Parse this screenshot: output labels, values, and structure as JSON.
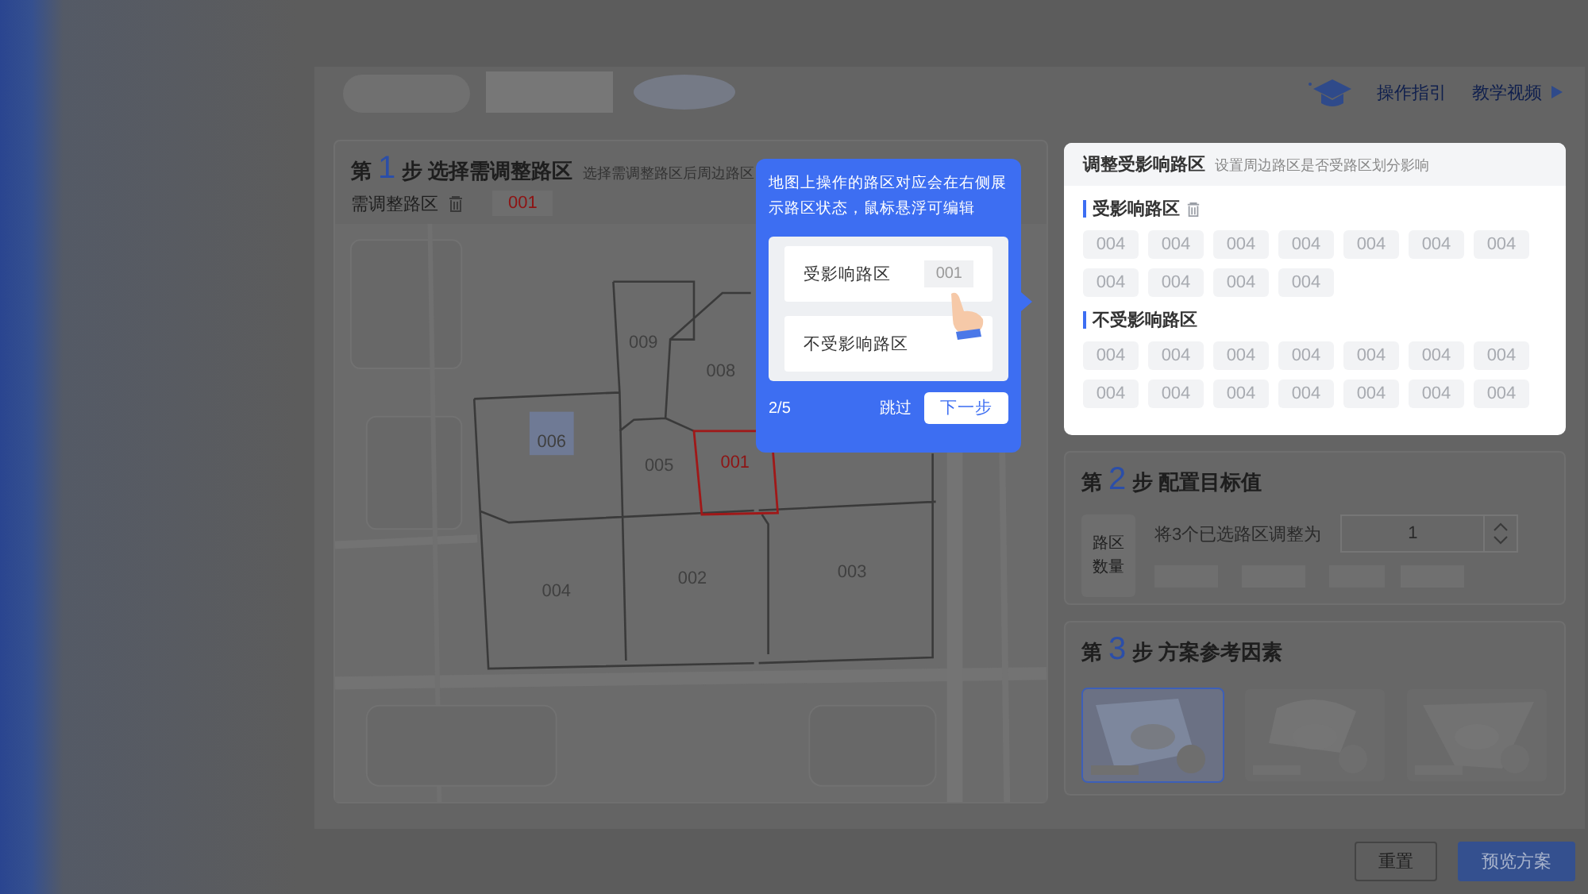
{
  "header": {
    "links": [
      {
        "label": "操作指引",
        "kind": "plain"
      },
      {
        "label": "教学视频",
        "kind": "play"
      }
    ]
  },
  "step1": {
    "prefix": "第",
    "number": "1",
    "suffix": "步",
    "title": "选择需调整路区",
    "hint": "选择需调整路区后周边路区",
    "field_label": "需调整路区",
    "selected_chip": "001",
    "districts": [
      {
        "label": "009",
        "selected": false,
        "highlighted": false
      },
      {
        "label": "008",
        "selected": false,
        "highlighted": false
      },
      {
        "label": "006",
        "selected": false,
        "highlighted": true
      },
      {
        "label": "005",
        "selected": false,
        "highlighted": false
      },
      {
        "label": "001",
        "selected": true,
        "highlighted": false
      },
      {
        "label": "004",
        "selected": false,
        "highlighted": false
      },
      {
        "label": "002",
        "selected": false,
        "highlighted": false
      },
      {
        "label": "003",
        "selected": false,
        "highlighted": false
      }
    ]
  },
  "affected_panel": {
    "title": "调整受影响路区",
    "subtitle": "设置周边路区是否受路区划分影响",
    "groups": [
      {
        "title": "受影响路区",
        "deletable": true,
        "chips": [
          "004",
          "004",
          "004",
          "004",
          "004",
          "004",
          "004",
          "004",
          "004",
          "004",
          "004"
        ]
      },
      {
        "title": "不受影响路区",
        "deletable": false,
        "chips": [
          "004",
          "004",
          "004",
          "004",
          "004",
          "004",
          "004",
          "004",
          "004",
          "004",
          "004",
          "004",
          "004",
          "004"
        ]
      }
    ]
  },
  "step2": {
    "prefix": "第",
    "number": "2",
    "suffix": "步",
    "title": "配置目标值",
    "label": "路区数量",
    "sentence": "将3个已选路区调整为",
    "value": "1"
  },
  "step3": {
    "prefix": "第",
    "number": "3",
    "suffix": "步",
    "title": "方案参考因素",
    "options": [
      {
        "kind": "picture",
        "selected": true
      },
      {
        "kind": "picture",
        "selected": false
      },
      {
        "kind": "picture",
        "selected": false
      }
    ]
  },
  "tour": {
    "text": "地图上操作的路区对应会在右侧展示路区状态，鼠标悬浮可编辑",
    "rows": [
      {
        "label": "受影响路区",
        "chip": "001"
      },
      {
        "label": "不受影响路区"
      }
    ],
    "progress": "2/5",
    "skip": "跳过",
    "next": "下一步"
  },
  "footer": {
    "buttons": [
      {
        "label": "重置",
        "primary": false
      },
      {
        "label": "预览方案",
        "primary": true
      }
    ]
  }
}
